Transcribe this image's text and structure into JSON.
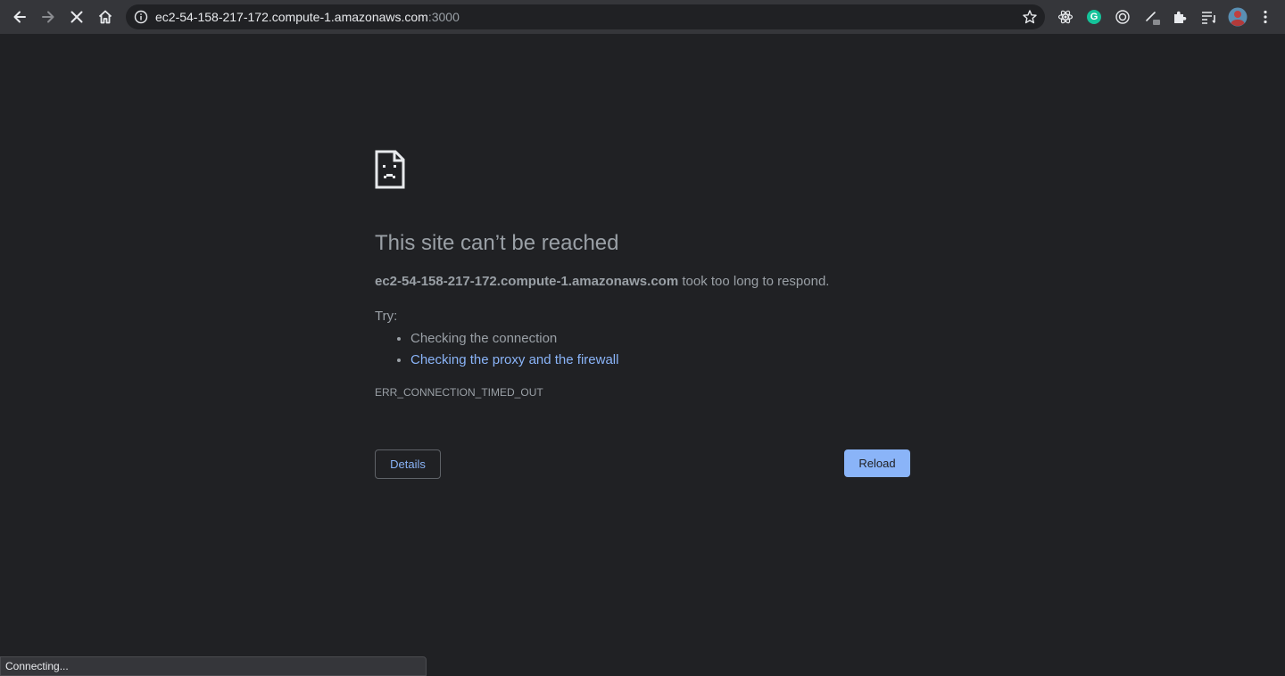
{
  "browser": {
    "url_host": "ec2-54-158-217-172.compute-1.amazonaws.com",
    "url_port": ":3000",
    "icons": {
      "back": "back-arrow-icon",
      "forward": "forward-arrow-icon",
      "stop": "stop-loading-icon",
      "home": "home-icon",
      "site_info": "info-icon",
      "bookmark": "star-icon",
      "extensions": [
        "react-devtools-icon",
        "grammarly-icon",
        "target-extension-icon",
        "pen-extension-icon",
        "extensions-puzzle-icon",
        "reading-list-icon",
        "profile-avatar",
        "menu-kebab-icon"
      ]
    },
    "grammarly_letter": "G",
    "colors": {
      "toolbar": "#35363a",
      "page_bg": "#202124",
      "accent": "#8ab4f8",
      "grammarly": "#15c39a"
    }
  },
  "error_page": {
    "icon": "sad-page-icon",
    "heading": "This site can’t be reached",
    "host": "ec2-54-158-217-172.compute-1.amazonaws.com",
    "summary_rest": " took too long to respond.",
    "try_label": "Try:",
    "suggestions": [
      "Checking the connection",
      "Checking the proxy and the firewall"
    ],
    "error_code": "ERR_CONNECTION_TIMED_OUT",
    "details_label": "Details",
    "reload_label": "Reload"
  },
  "status": {
    "text": "Connecting..."
  }
}
